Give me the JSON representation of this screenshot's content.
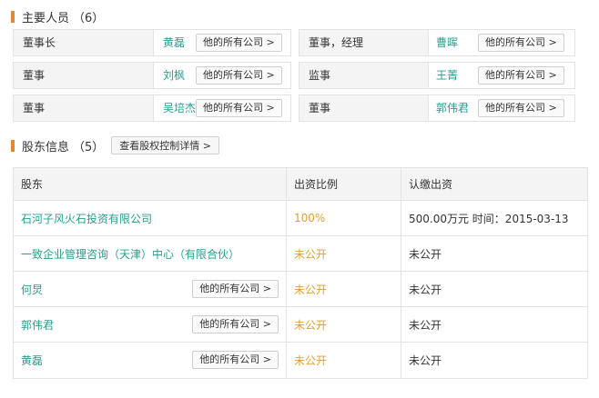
{
  "personnel": {
    "title": "主要人员",
    "count": "（6）",
    "people": [
      {
        "role": "董事长",
        "name": "黄磊",
        "button": "他的所有公司 >"
      },
      {
        "role": "董事，经理",
        "name": "曹晖",
        "button": "他的所有公司 >"
      },
      {
        "role": "董事",
        "name": "刘枫",
        "button": "他的所有公司 >"
      },
      {
        "role": "监事",
        "name": "王菁",
        "button": "他的所有公司 >"
      },
      {
        "role": "董事",
        "name": "吴培杰",
        "button": "他的所有公司 >"
      },
      {
        "role": "董事",
        "name": "郭伟君",
        "button": "他的所有公司 >"
      }
    ]
  },
  "shareholders": {
    "title": "股东信息",
    "count": "（5）",
    "control_button": "查看股权控制详情 >",
    "headers": {
      "holder": "股东",
      "ratio": "出资比例",
      "paid": "认缴出资"
    },
    "rows": [
      {
        "name": "石河子风火石投资有限公司",
        "ratio": "100%",
        "paid": "500.00万元 时间：2015-03-13",
        "button": ""
      },
      {
        "name": "一致企业管理咨询（天津）中心（有限合伙）",
        "ratio": "未公开",
        "paid": "未公开",
        "button": ""
      },
      {
        "name": "何炅",
        "ratio": "未公开",
        "paid": "未公开",
        "button": "他的所有公司 >"
      },
      {
        "name": "郭伟君",
        "ratio": "未公开",
        "paid": "未公开",
        "button": "他的所有公司 >"
      },
      {
        "name": "黄磊",
        "ratio": "未公开",
        "paid": "未公开",
        "button": "他的所有公司 >"
      }
    ]
  }
}
